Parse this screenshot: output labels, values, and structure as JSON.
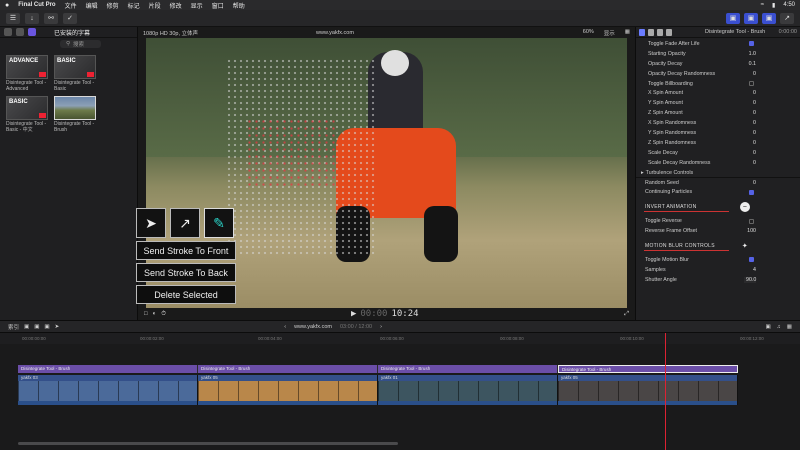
{
  "menubar": {
    "apple": "",
    "app": "Final Cut Pro",
    "items": [
      "文件",
      "编辑",
      "修剪",
      "标记",
      "片段",
      "修改",
      "显示",
      "窗口",
      "帮助"
    ],
    "clock": "4:50"
  },
  "library": {
    "title": "已安装的字幕",
    "search_placeholder": "搜索",
    "thumbs": [
      {
        "label": "ADVANCE",
        "caption": "Disintegrate Tool - Advanced"
      },
      {
        "label": "BASIC",
        "caption": "Disintegrate Tool - Basic"
      },
      {
        "label": "BASIC",
        "caption": "Disintegrate Tool - Basic - 中文"
      },
      {
        "label": "",
        "caption": "Disintegrate Tool - Brush"
      }
    ]
  },
  "viewer": {
    "format": "1080p HD 30p, 立体声",
    "source": "www.yakfx.com",
    "zoom": "60%",
    "view": "显示",
    "timecode_dim": "00:00",
    "timecode": "10:24"
  },
  "tools_overlay": {
    "buttons": [
      "Send Stroke To Front",
      "Send Stroke To Back",
      "Delete Selected"
    ]
  },
  "inspector": {
    "title": "Disintegrate Tool - Brush",
    "time": "0:00:00",
    "rows_top": [
      {
        "label": "Toggle Fade After Life",
        "type": "check"
      },
      {
        "label": "Starting Opacity",
        "value": "1.0"
      },
      {
        "label": "Opacity Decay",
        "value": "0.1"
      },
      {
        "label": "Opacity Decay Randomness",
        "value": "0"
      },
      {
        "label": "Toggle Billboarding",
        "type": "check-off"
      },
      {
        "label": "X Spin Amount",
        "value": "0"
      },
      {
        "label": "Y Spin Amount",
        "value": "0"
      },
      {
        "label": "Z Spin Amount",
        "value": "0"
      },
      {
        "label": "X Spin Randomness",
        "value": "0"
      },
      {
        "label": "Y Spin Randomness",
        "value": "0"
      },
      {
        "label": "Z Spin Randomness",
        "value": "0"
      },
      {
        "label": "Scale Decay",
        "value": "0"
      },
      {
        "label": "Scale Decay Randomness",
        "value": "0"
      }
    ],
    "turbulence": "Turbulence Controls",
    "random_seed": {
      "label": "Random Seed",
      "value": "0"
    },
    "continuing": "Continuing Particles",
    "invert_section": "INVERT ANIMATION",
    "toggle_reverse": "Toggle Reverse",
    "reverse_offset": {
      "label": "Reverse Frame Offset",
      "value": "100"
    },
    "motion_section": "MOTION BLUR CONTROLS",
    "toggle_motion_blur": "Toggle Motion Blur",
    "samples": {
      "label": "Samples",
      "value": "4"
    },
    "shutter": {
      "label": "Shutter Angle",
      "value": "90.0"
    }
  },
  "timeline": {
    "index": "索引",
    "project": "www.yakfx.com",
    "duration": "03:00 / 12:00",
    "ruler": [
      "00:00:00:00",
      "00:00:02:00",
      "00:00:04:00",
      "00:00:06:00",
      "00:00:08:00",
      "00:00:10:00",
      "00:00:12:00"
    ],
    "title_clips": [
      "Disintegrate Tool - Brush",
      "Disintegrate Tool - Brush",
      "Disintegrate Tool - Brush",
      "Disintegrate Tool - Brush"
    ],
    "video_clips": [
      "yakfx 03",
      "yakfx 05",
      "yakfx 01",
      "yakfx 05"
    ]
  }
}
